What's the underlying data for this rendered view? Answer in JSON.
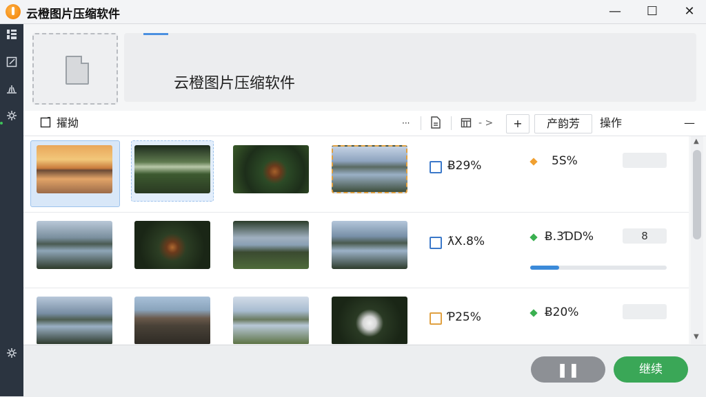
{
  "window": {
    "title": "云橙图片压缩软件",
    "minimize": "—",
    "maximize": "☐",
    "close": "✕"
  },
  "sidebar": {
    "icons": [
      "layout-icon",
      "edit-icon",
      "chart-icon",
      "settings-icon",
      "gear-icon"
    ]
  },
  "banner": {
    "title": "云橙图片压缩软件"
  },
  "toolbar": {
    "select_label": "擢拗",
    "ellipsis": "···",
    "arrow": "- >",
    "plus": "+",
    "produce_label": "产韵芳",
    "operation_label": "操作",
    "collapse": "—"
  },
  "rows": [
    {
      "percent": "Ƀ29%",
      "status": "5S%",
      "status_color": "#f0a030",
      "pill": "",
      "progress": null,
      "checkbox_color": "#3a78c9"
    },
    {
      "percent": "ƛX.8%",
      "status": "Ƀ.3ƊD%",
      "status_color": "#3ab050",
      "pill": "8",
      "progress": 0.21,
      "checkbox_color": "#3a78c9"
    },
    {
      "percent": "Ƥ25%",
      "status": "Ƀ20%",
      "status_color": "#3ab050",
      "pill": "",
      "progress": null,
      "checkbox_color": "#e0a040"
    }
  ],
  "buttons": {
    "pause": "❚❚",
    "continue": "继续"
  }
}
